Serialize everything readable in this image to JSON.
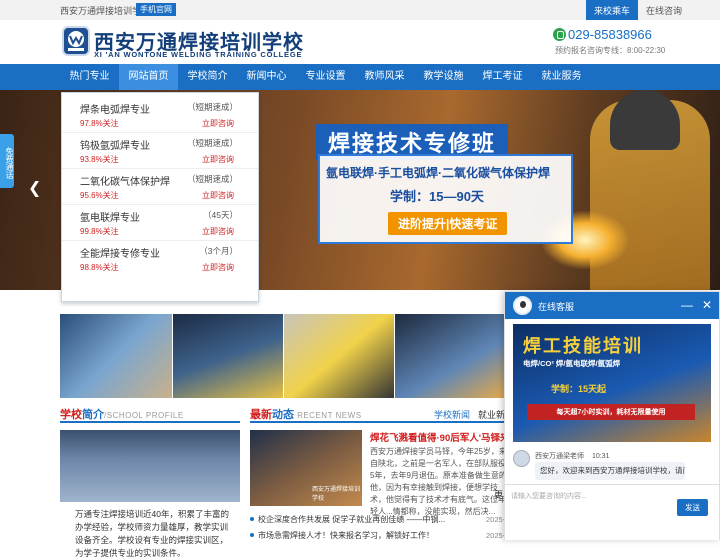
{
  "topbar": {
    "site_name": "西安万通焊接培训学校",
    "mobile_badge": "手机官网",
    "bus_link": "来校乘车",
    "consult_link": "在线咨询"
  },
  "header": {
    "logo_cn": "西安万通焊接培训学校",
    "logo_en": "XI 'AN WONTONE WELDING TRAINING COLLEGE",
    "phone": "029-85838966",
    "hotline": "预约报名咨询专线：8:00-22:30"
  },
  "nav": {
    "items": [
      {
        "label": "热门专业"
      },
      {
        "label": "网站首页"
      },
      {
        "label": "学校简介"
      },
      {
        "label": "新闻中心"
      },
      {
        "label": "专业设置"
      },
      {
        "label": "教师风采"
      },
      {
        "label": "教学设施"
      },
      {
        "label": "焊工考证"
      },
      {
        "label": "就业服务"
      }
    ],
    "active_index": 1
  },
  "float_tab": {
    "label": "免费通话"
  },
  "banner": {
    "title": "焊接技术专修班",
    "subtitle": "氩电联焊·手工电弧焊·二氧化碳气体保护焊",
    "term": "学制：15—90天",
    "button": "进阶提升|快速考证"
  },
  "courses": [
    {
      "name": "焊条电弧焊专业",
      "term": "（短期速成）",
      "attention": "97.8%关注",
      "consult": "立即咨询"
    },
    {
      "name": "钨极氩弧焊专业",
      "term": "（短期速成）",
      "attention": "93.8%关注",
      "consult": "立即咨询"
    },
    {
      "name": "二氧化碳气体保护焊",
      "term": "（短期速成）",
      "attention": "95.6%关注",
      "consult": "立即咨询"
    },
    {
      "name": "氩电联焊专业",
      "term": "（45天）",
      "attention": "99.8%关注",
      "consult": "立即咨询"
    },
    {
      "name": "全能焊接专修专业",
      "term": "（3个月）",
      "attention": "98.8%关注",
      "consult": "立即咨询"
    }
  ],
  "school": {
    "title_red": "学校",
    "title_blue": "简介",
    "title_en": "/SCHOOL PROFILE",
    "text": "万通专注焊接培训近40年，积累了丰富的办学经验，学校师资力量雄厚，教学实训设备齐全。学校设有专业的焊接实训区，为学子提供专业的实训条件。"
  },
  "news": {
    "title_red": "最新",
    "title_blue": "动态",
    "title_en": "RECENT NEWS",
    "tab_school": "学校新闻",
    "tab_jobs": "就业新闻",
    "img_caption": "西安万通焊接培训学校",
    "headline": "焊花飞溅看值得·90后军人'马铎来...",
    "summary": "西安万通焊接学员马铎，今年25岁，来自陕北，之前是一名军人，在部队服役5年，去年9月退伍。原本准备做生意的他，因为有幸接触到焊接，便想学技术，他觉得有了技术才有底气。这位年轻人...情都称，没能实现，然后决...",
    "more": "更",
    "items": [
      {
        "text": "校企深度合作共发展 促学子就业再创佳绩 ——中钢...",
        "date": "2025-0"
      },
      {
        "text": "市场急需焊接人才！快来报名学习，解锁好工作！",
        "date": "2025-0"
      }
    ]
  },
  "chat": {
    "title": "在线客服",
    "ad_title": "焊工技能培训",
    "ad_sub": "电焊/CO² 焊/氩电联焊/氩弧焊",
    "ad_term": "学制：15天起",
    "ad_foot": "每天超7小时实训，耗材无限量使用",
    "msg_name": "西安万通梁老师",
    "msg_time": "10:31",
    "msg_text": "您好，欢迎来到西安万通焊接培训学校，请问想学焊工吗？",
    "input_placeholder": "请输入您要咨询的内容...",
    "send_label": "发送"
  },
  "colors": {
    "brand_blue": "#1a6fc4",
    "accent_red": "#d21f1f",
    "orange": "#f29400"
  }
}
